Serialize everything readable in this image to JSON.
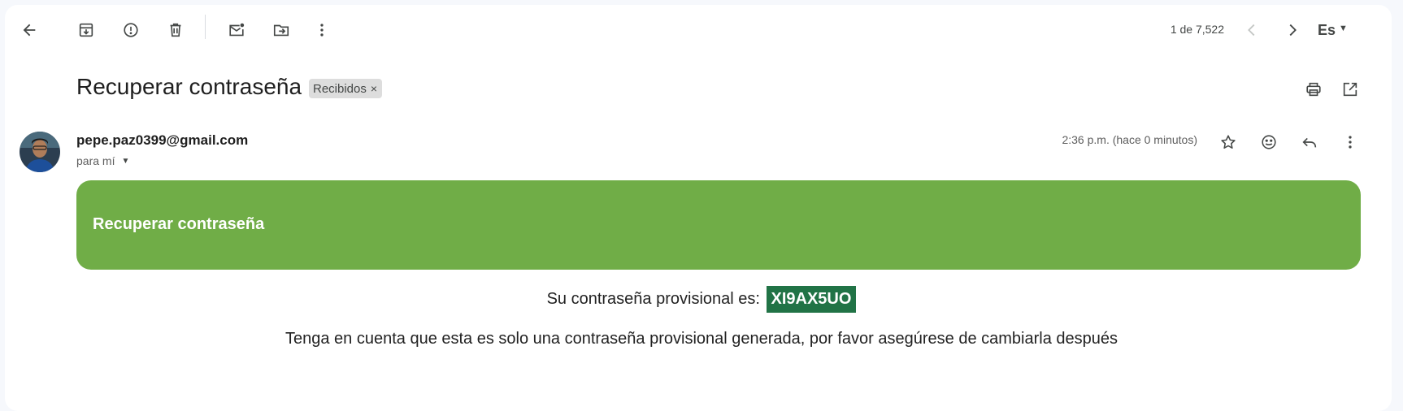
{
  "toolbar": {
    "icons": [
      "back-arrow-icon",
      "archive-icon",
      "report-spam-icon",
      "delete-icon",
      "mark-unread-icon",
      "move-to-icon",
      "more-vert-icon"
    ],
    "pager_text": "1 de 7,522",
    "language": "Es"
  },
  "message": {
    "subject": "Recuperar contraseña",
    "label": "Recibidos",
    "label_remove": "×",
    "sender": "pepe.paz0399@gmail.com",
    "recipients": "para mí",
    "timestamp": "2:36 p.m. (hace 0 minutos)"
  },
  "body": {
    "banner_title": "Recuperar contraseña",
    "banner_color": "#70ad47",
    "password_prefix": "Su contraseña provisional es:",
    "password_code": "XI9AX5UO",
    "password_code_bg": "#217346",
    "note": "Tenga en cuenta que esta es solo una contraseña provisional generada, por favor asegúrese de cambiarla después"
  }
}
